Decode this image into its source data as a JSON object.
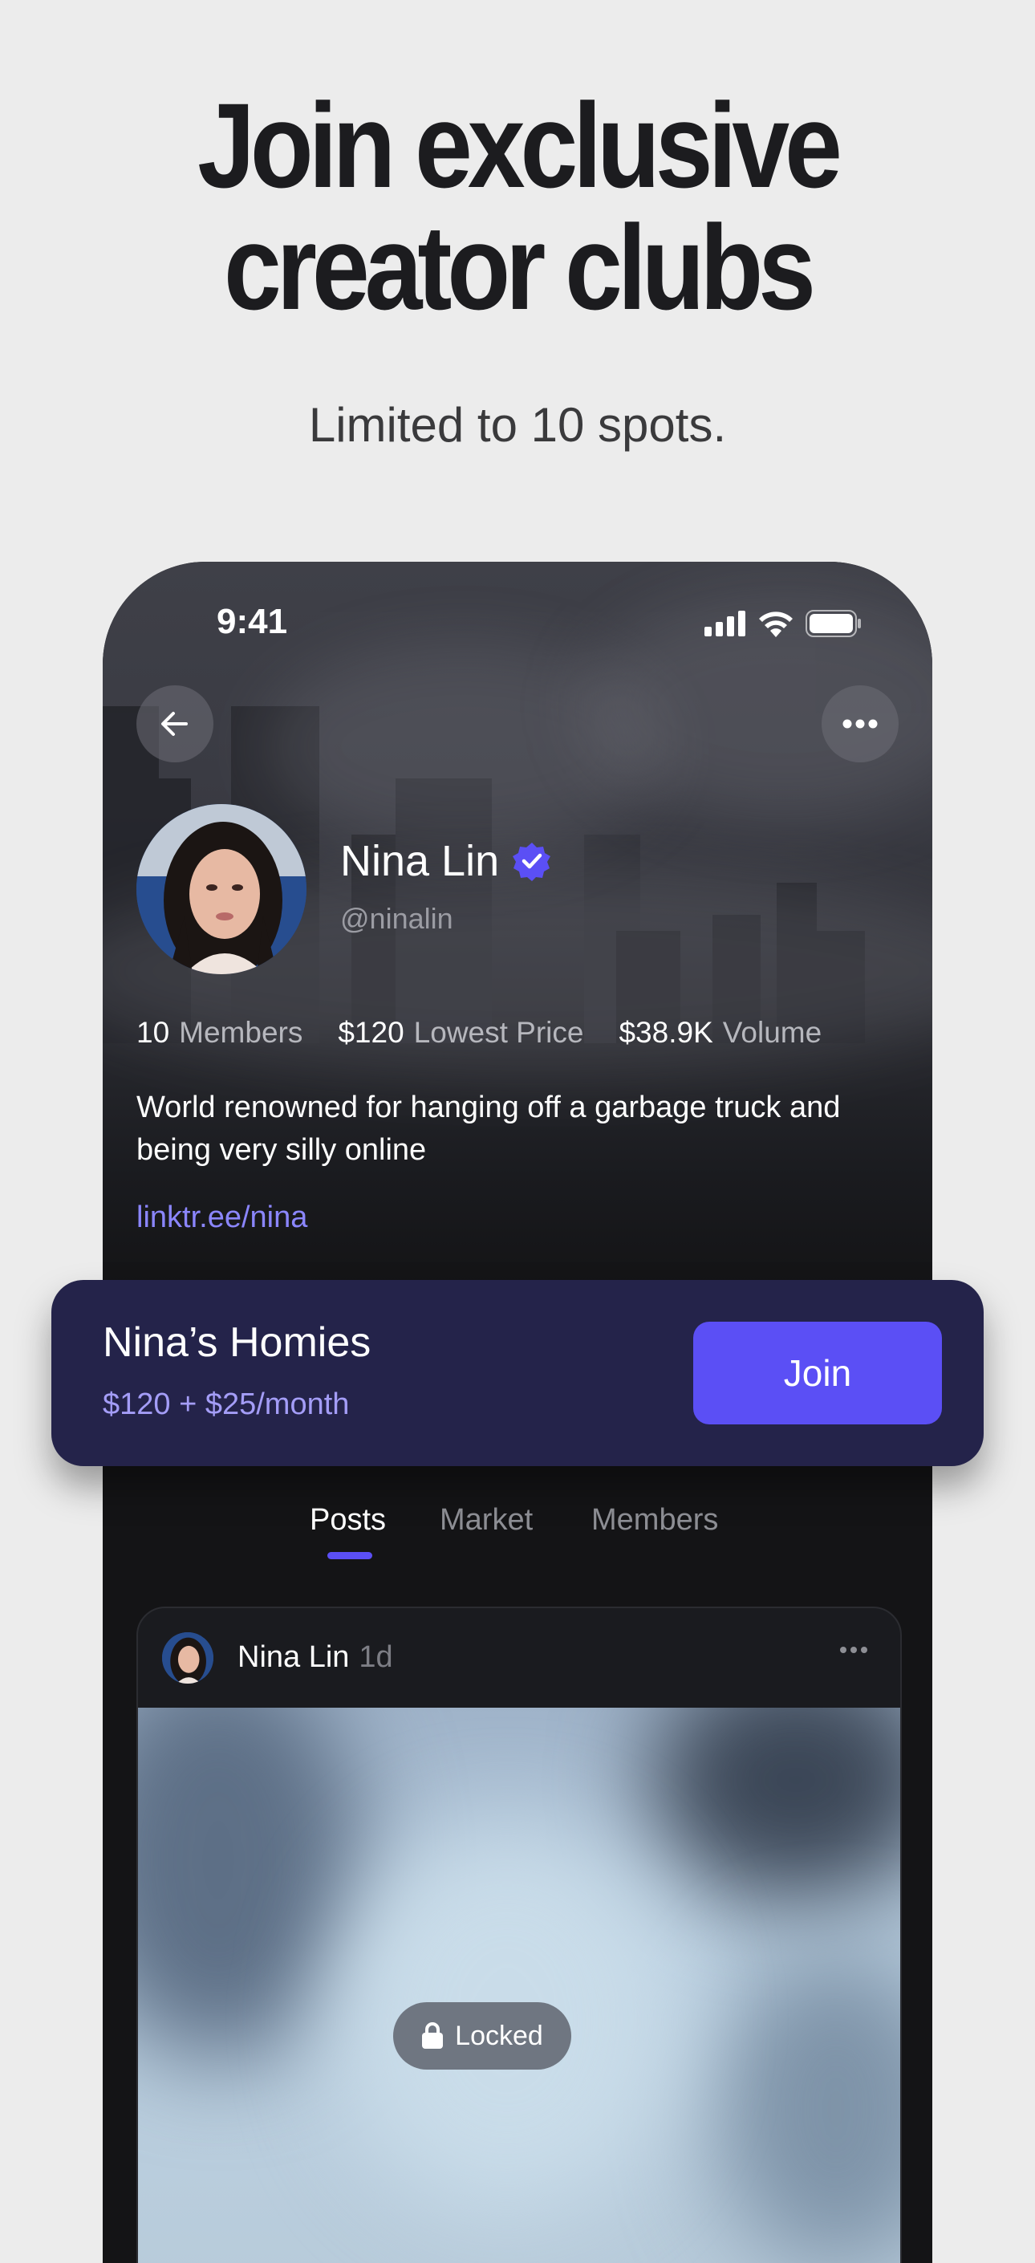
{
  "headline": {
    "line1": "Join exclusive",
    "line2": "creator clubs"
  },
  "subline": "Limited to 10 spots.",
  "status_bar": {
    "time": "9:41"
  },
  "profile": {
    "name": "Nina Lin",
    "handle": "@ninalin",
    "verified": true,
    "stats": [
      {
        "value": "10",
        "label": "Members"
      },
      {
        "value": "$120",
        "label": "Lowest Price"
      },
      {
        "value": "$38.9K",
        "label": "Volume"
      }
    ],
    "bio": "World renowned for hanging off a garbage truck and being very silly online",
    "link": "linktr.ee/nina"
  },
  "club": {
    "title": "Nina’s Homies",
    "price": "$120 + $25/month",
    "join_label": "Join"
  },
  "tabs": [
    {
      "label": "Posts",
      "active": true
    },
    {
      "label": "Market",
      "active": false
    },
    {
      "label": "Members",
      "active": false
    }
  ],
  "post": {
    "author": "Nina Lin",
    "age": "1d",
    "locked_label": "Locked"
  },
  "colors": {
    "accent": "#5b4ff5",
    "link": "#8b86ff",
    "club_bg": "#24234a",
    "background": "#ececec"
  },
  "icons": [
    "back-arrow-icon",
    "more-icon",
    "verified-badge-icon",
    "signal-icon",
    "wifi-icon",
    "battery-icon",
    "lock-icon"
  ]
}
